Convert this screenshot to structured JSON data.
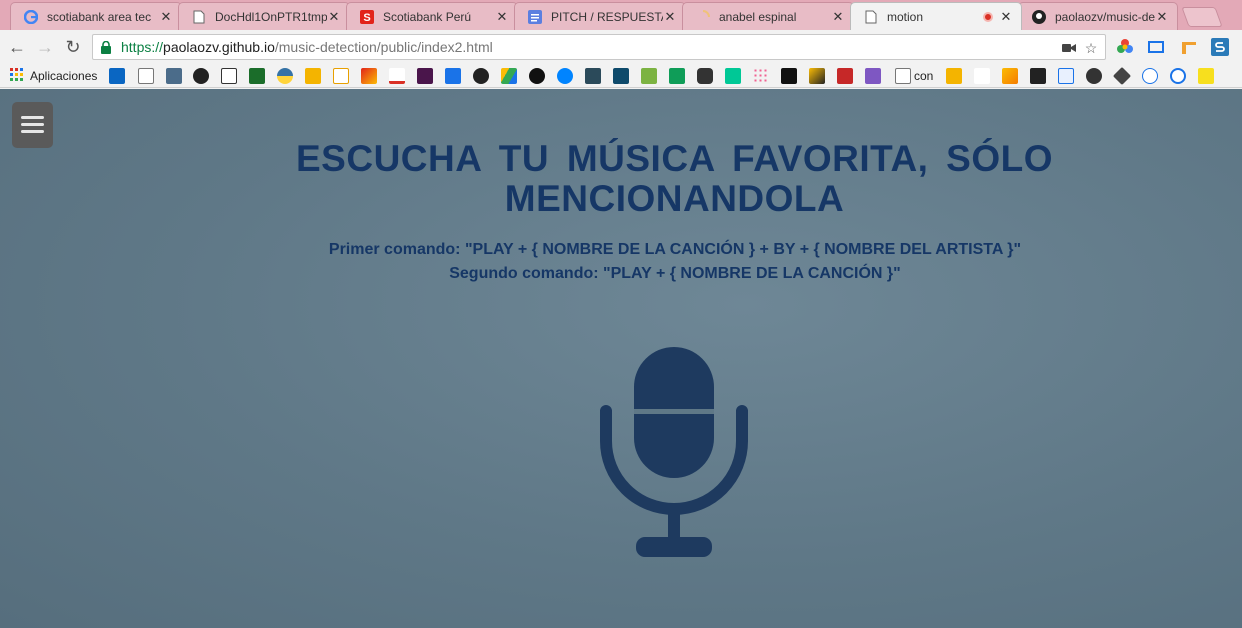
{
  "browser": {
    "tabs": [
      {
        "label": "scotiabank area tec",
        "favicon": "google-icon"
      },
      {
        "label": "DocHdl1OnPTR1tmp",
        "favicon": "document-icon"
      },
      {
        "label": "Scotiabank Perú",
        "favicon": "scotiabank-icon"
      },
      {
        "label": "PITCH / RESPUESTA",
        "favicon": "docs-icon"
      },
      {
        "label": "anabel espinal",
        "favicon": "loading-icon"
      },
      {
        "label": "motion",
        "favicon": "document-icon"
      },
      {
        "label": "paolaozv/music-det",
        "favicon": "github-icon"
      }
    ],
    "url": {
      "protocol": "https://",
      "host": "paolaozv.github.io",
      "path": "/music-detection/public/index2.html"
    },
    "bookmarks_label": "Aplicaciones",
    "bookmark_con_label": "con"
  },
  "page": {
    "headline": "ESCUCHA TU MÚSICA FAVORITA, SÓLO MENCIONANDOLA",
    "command_1": "Primer comando: \"PLAY + { NOMBRE DE LA CANCIÓN } + BY + { NOMBRE DEL ARTISTA }\"",
    "command_2": "Segundo comando: \"PLAY + { NOMBRE DE LA CANCIÓN }\""
  },
  "colors": {
    "tabstrip": "#e3a9b7",
    "page_background": "#607a89",
    "text_accent": "#163766",
    "mic": "#1e3a5f"
  }
}
